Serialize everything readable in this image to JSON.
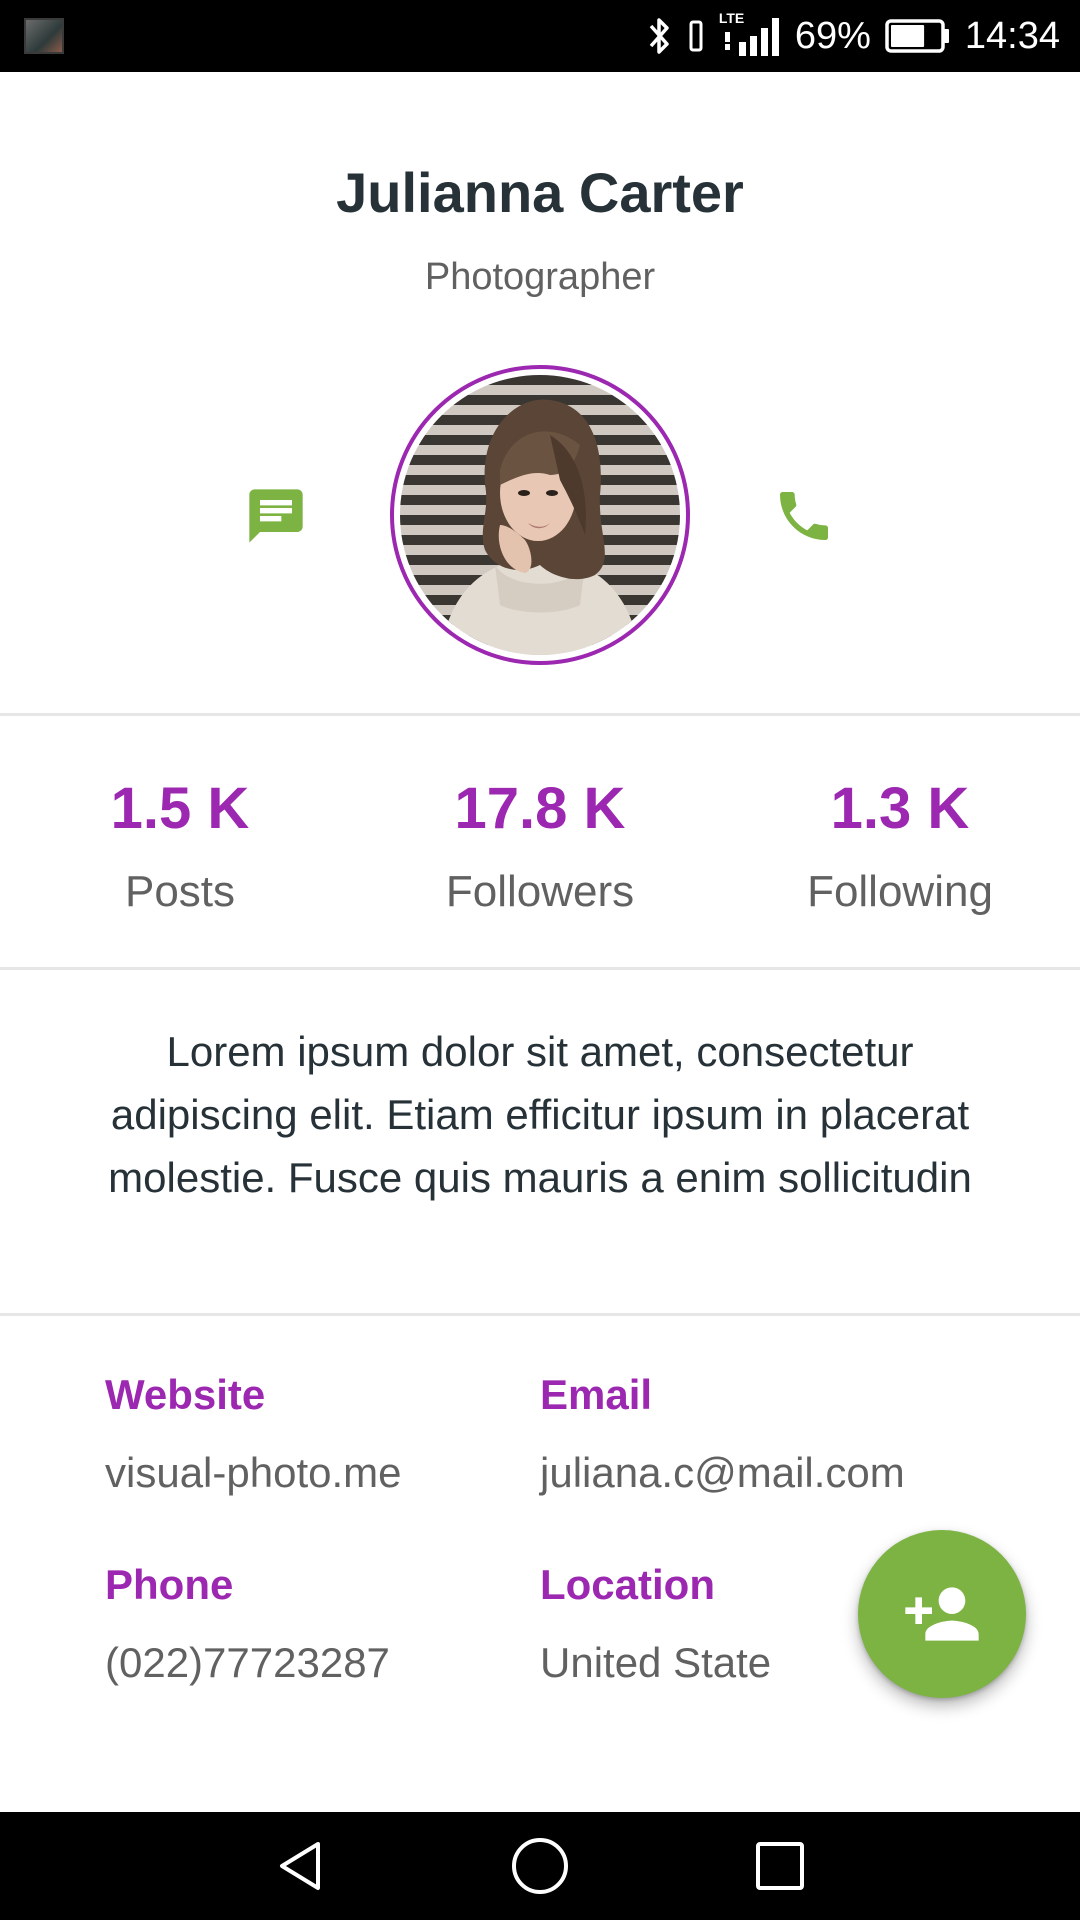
{
  "status_bar": {
    "battery_percent": "69%",
    "time": "14:34",
    "network_label": "LTE",
    "battery_level": 0.69
  },
  "profile": {
    "name": "Julianna Carter",
    "role": "Photographer"
  },
  "stats": [
    {
      "value": "1.5 K",
      "label": "Posts"
    },
    {
      "value": "17.8 K",
      "label": "Followers"
    },
    {
      "value": "1.3 K",
      "label": "Following"
    }
  ],
  "bio": "Lorem ipsum dolor sit amet, consectetur adipiscing elit. Etiam efficitur ipsum in placerat molestie. Fusce quis mauris a enim sollicitudin",
  "details": {
    "website": {
      "label": "Website",
      "value": "visual-photo.me"
    },
    "email": {
      "label": "Email",
      "value": "juliana.c@mail.com"
    },
    "phone": {
      "label": "Phone",
      "value": "(022)77723287"
    },
    "location": {
      "label": "Location",
      "value": "United State"
    }
  },
  "icons": {
    "message": "message-icon",
    "call": "phone-icon",
    "fab": "person-add-icon",
    "nav_back": "back-triangle-icon",
    "nav_home": "home-circle-icon",
    "nav_recents": "recents-square-icon"
  },
  "colors": {
    "accent_purple": "#9c27b0",
    "accent_green": "#7cb342",
    "text_dark": "#263238",
    "text_gray": "#616161"
  }
}
